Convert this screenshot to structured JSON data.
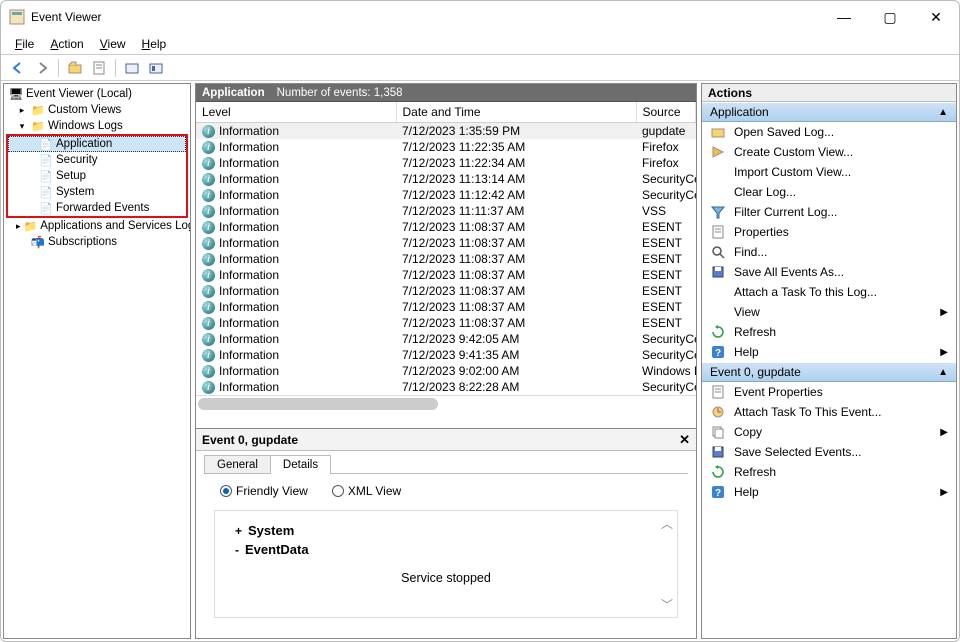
{
  "window": {
    "title": "Event Viewer",
    "minimize": "—",
    "maximize": "▢",
    "close": "✕"
  },
  "menu": [
    "File",
    "Action",
    "View",
    "Help"
  ],
  "tree": {
    "root": "Event Viewer (Local)",
    "custom_views": "Custom Views",
    "windows_logs": "Windows Logs",
    "windows_logs_children": [
      "Application",
      "Security",
      "Setup",
      "System",
      "Forwarded Events"
    ],
    "app_services": "Applications and Services Logs",
    "subscriptions": "Subscriptions"
  },
  "center_header": {
    "title": "Application",
    "count_label": "Number of events: 1,358"
  },
  "columns": {
    "level": "Level",
    "date": "Date and Time",
    "source": "Source"
  },
  "events": [
    {
      "level": "Information",
      "date": "7/12/2023 1:35:59 PM",
      "source": "gupdate"
    },
    {
      "level": "Information",
      "date": "7/12/2023 11:22:35 AM",
      "source": "Firefox"
    },
    {
      "level": "Information",
      "date": "7/12/2023 11:22:34 AM",
      "source": "Firefox"
    },
    {
      "level": "Information",
      "date": "7/12/2023 11:13:14 AM",
      "source": "SecurityCenter"
    },
    {
      "level": "Information",
      "date": "7/12/2023 11:12:42 AM",
      "source": "SecurityCenter"
    },
    {
      "level": "Information",
      "date": "7/12/2023 11:11:37 AM",
      "source": "VSS"
    },
    {
      "level": "Information",
      "date": "7/12/2023 11:08:37 AM",
      "source": "ESENT"
    },
    {
      "level": "Information",
      "date": "7/12/2023 11:08:37 AM",
      "source": "ESENT"
    },
    {
      "level": "Information",
      "date": "7/12/2023 11:08:37 AM",
      "source": "ESENT"
    },
    {
      "level": "Information",
      "date": "7/12/2023 11:08:37 AM",
      "source": "ESENT"
    },
    {
      "level": "Information",
      "date": "7/12/2023 11:08:37 AM",
      "source": "ESENT"
    },
    {
      "level": "Information",
      "date": "7/12/2023 11:08:37 AM",
      "source": "ESENT"
    },
    {
      "level": "Information",
      "date": "7/12/2023 11:08:37 AM",
      "source": "ESENT"
    },
    {
      "level": "Information",
      "date": "7/12/2023 9:42:05 AM",
      "source": "SecurityCenter"
    },
    {
      "level": "Information",
      "date": "7/12/2023 9:41:35 AM",
      "source": "SecurityCenter"
    },
    {
      "level": "Information",
      "date": "7/12/2023 9:02:00 AM",
      "source": "Windows Error Reporting"
    },
    {
      "level": "Information",
      "date": "7/12/2023 8:22:28 AM",
      "source": "SecurityCenter"
    }
  ],
  "details": {
    "title": "Event 0, gupdate",
    "tabs": [
      "General",
      "Details"
    ],
    "friendly": "Friendly View",
    "xml": "XML View",
    "system": "System",
    "eventdata": "EventData",
    "message": "Service stopped"
  },
  "actions": {
    "header": "Actions",
    "sections": [
      {
        "title": "Application",
        "items": [
          {
            "icon": "open",
            "label": "Open Saved Log..."
          },
          {
            "icon": "create",
            "label": "Create Custom View..."
          },
          {
            "icon": "",
            "label": "Import Custom View..."
          },
          {
            "icon": "",
            "label": "Clear Log..."
          },
          {
            "icon": "filter",
            "label": "Filter Current Log..."
          },
          {
            "icon": "props",
            "label": "Properties"
          },
          {
            "icon": "find",
            "label": "Find..."
          },
          {
            "icon": "save",
            "label": "Save All Events As..."
          },
          {
            "icon": "",
            "label": "Attach a Task To this Log..."
          },
          {
            "icon": "",
            "label": "View",
            "arrow": true
          },
          {
            "icon": "refresh",
            "label": "Refresh"
          },
          {
            "icon": "help",
            "label": "Help",
            "arrow": true
          }
        ]
      },
      {
        "title": "Event 0, gupdate",
        "items": [
          {
            "icon": "props",
            "label": "Event Properties"
          },
          {
            "icon": "task",
            "label": "Attach Task To This Event..."
          },
          {
            "icon": "copy",
            "label": "Copy",
            "arrow": true
          },
          {
            "icon": "save",
            "label": "Save Selected Events..."
          },
          {
            "icon": "refresh",
            "label": "Refresh"
          },
          {
            "icon": "help",
            "label": "Help",
            "arrow": true
          }
        ]
      }
    ]
  }
}
